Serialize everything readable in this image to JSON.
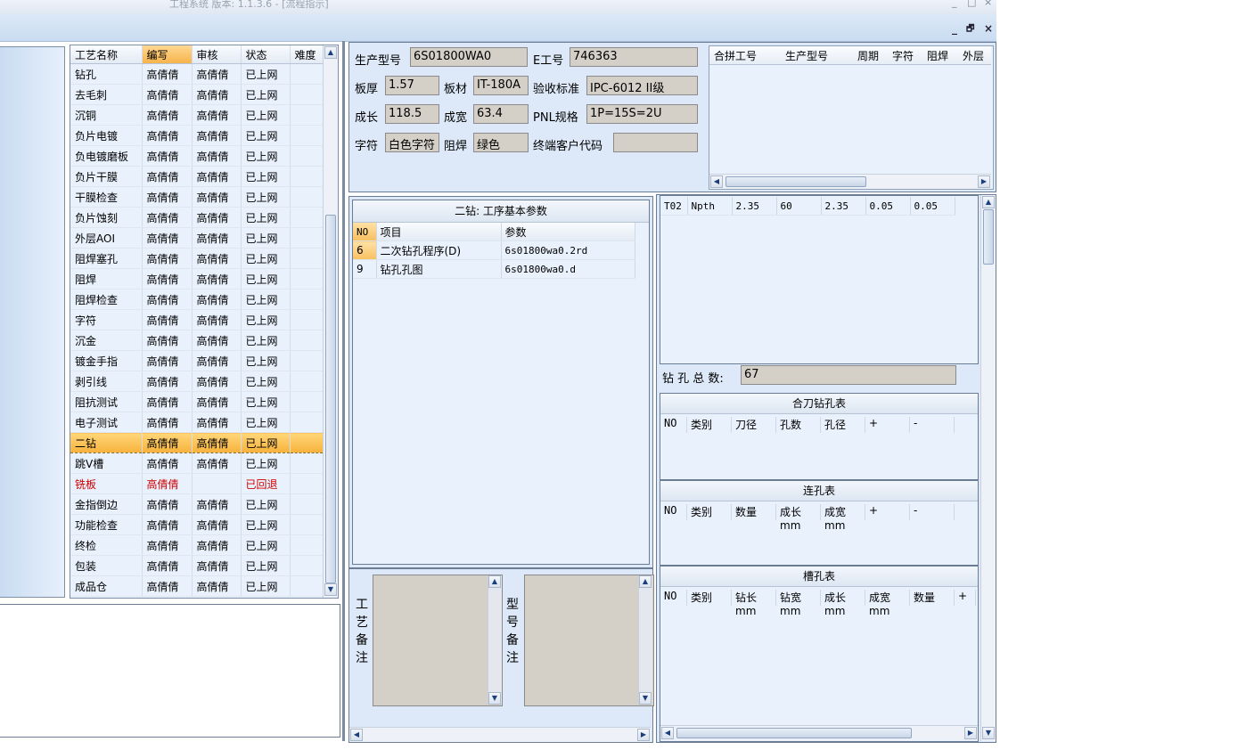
{
  "window": {
    "title": "工程系统 版本: 1.1.3.6 - [流程指示]",
    "controls": [
      "_",
      "□",
      "×"
    ],
    "mdi_controls": [
      "_",
      "🗗",
      "×"
    ]
  },
  "process_list": {
    "columns": [
      "工艺名称",
      "编写",
      "审核",
      "状态",
      "难度"
    ],
    "rows": [
      {
        "name": "钻孔",
        "writer": "高倩倩",
        "reviewer": "高倩倩",
        "status": "已上网",
        "difficulty": ""
      },
      {
        "name": "去毛刺",
        "writer": "高倩倩",
        "reviewer": "高倩倩",
        "status": "已上网",
        "difficulty": ""
      },
      {
        "name": "沉铜",
        "writer": "高倩倩",
        "reviewer": "高倩倩",
        "status": "已上网",
        "difficulty": ""
      },
      {
        "name": "负片电镀",
        "writer": "高倩倩",
        "reviewer": "高倩倩",
        "status": "已上网",
        "difficulty": ""
      },
      {
        "name": "负电镀磨板",
        "writer": "高倩倩",
        "reviewer": "高倩倩",
        "status": "已上网",
        "difficulty": ""
      },
      {
        "name": "负片干膜",
        "writer": "高倩倩",
        "reviewer": "高倩倩",
        "status": "已上网",
        "difficulty": ""
      },
      {
        "name": "干膜检查",
        "writer": "高倩倩",
        "reviewer": "高倩倩",
        "status": "已上网",
        "difficulty": ""
      },
      {
        "name": "负片蚀刻",
        "writer": "高倩倩",
        "reviewer": "高倩倩",
        "status": "已上网",
        "difficulty": ""
      },
      {
        "name": "外层AOI",
        "writer": "高倩倩",
        "reviewer": "高倩倩",
        "status": "已上网",
        "difficulty": ""
      },
      {
        "name": "阻焊塞孔",
        "writer": "高倩倩",
        "reviewer": "高倩倩",
        "status": "已上网",
        "difficulty": ""
      },
      {
        "name": "阻焊",
        "writer": "高倩倩",
        "reviewer": "高倩倩",
        "status": "已上网",
        "difficulty": ""
      },
      {
        "name": "阻焊检查",
        "writer": "高倩倩",
        "reviewer": "高倩倩",
        "status": "已上网",
        "difficulty": ""
      },
      {
        "name": "字符",
        "writer": "高倩倩",
        "reviewer": "高倩倩",
        "status": "已上网",
        "difficulty": ""
      },
      {
        "name": "沉金",
        "writer": "高倩倩",
        "reviewer": "高倩倩",
        "status": "已上网",
        "difficulty": ""
      },
      {
        "name": "镀金手指",
        "writer": "高倩倩",
        "reviewer": "高倩倩",
        "status": "已上网",
        "difficulty": ""
      },
      {
        "name": "剥引线",
        "writer": "高倩倩",
        "reviewer": "高倩倩",
        "status": "已上网",
        "difficulty": ""
      },
      {
        "name": "阻抗测试",
        "writer": "高倩倩",
        "reviewer": "高倩倩",
        "status": "已上网",
        "difficulty": ""
      },
      {
        "name": "电子测试",
        "writer": "高倩倩",
        "reviewer": "高倩倩",
        "status": "已上网",
        "difficulty": ""
      },
      {
        "name": "二钻",
        "writer": "高倩倩",
        "reviewer": "高倩倩",
        "status": "已上网",
        "difficulty": "",
        "selected": true
      },
      {
        "name": "跳V槽",
        "writer": "高倩倩",
        "reviewer": "高倩倩",
        "status": "已上网",
        "difficulty": ""
      },
      {
        "name": "铣板",
        "writer": "高倩倩",
        "reviewer": "",
        "status": "已回退",
        "difficulty": "",
        "returned": true
      },
      {
        "name": "金指倒边",
        "writer": "高倩倩",
        "reviewer": "高倩倩",
        "status": "已上网",
        "difficulty": ""
      },
      {
        "name": "功能检查",
        "writer": "高倩倩",
        "reviewer": "高倩倩",
        "status": "已上网",
        "difficulty": ""
      },
      {
        "name": "终检",
        "writer": "高倩倩",
        "reviewer": "高倩倩",
        "status": "已上网",
        "difficulty": ""
      },
      {
        "name": "包装",
        "writer": "高倩倩",
        "reviewer": "高倩倩",
        "status": "已上网",
        "difficulty": ""
      },
      {
        "name": "成品仓",
        "writer": "高倩倩",
        "reviewer": "高倩倩",
        "status": "已上网",
        "difficulty": ""
      }
    ]
  },
  "info": {
    "model_label": "生产型号",
    "model_value": "6S01800WA0",
    "eno_label": "E工号",
    "eno_value": "746363",
    "thickness_label": "板厚",
    "thickness_value": "1.57",
    "material_label": "板材",
    "material_value": "IT-180A",
    "standard_label": "验收标准",
    "standard_value": "IPC-6012 II级",
    "length_label": "成长",
    "length_value": "118.5",
    "width_label": "成宽",
    "width_value": "63.4",
    "pnl_label": "PNL规格",
    "pnl_value": "1P=15S=2U",
    "char_label": "字符",
    "char_value": "白色字符",
    "mask_label": "阻焊",
    "mask_value": "绿色",
    "customer_label": "终端客户代码",
    "customer_value": ""
  },
  "merge_table": {
    "columns": [
      "合拼工号",
      "生产型号",
      "周期",
      "字符",
      "阻焊",
      "外层"
    ]
  },
  "params": {
    "title": "二钻: 工序基本参数",
    "columns": [
      "NO",
      "项目",
      "参数"
    ],
    "rows": [
      {
        "no": "6",
        "item": "二次钻孔程序(D)",
        "value": "6s01800wa0.2rd"
      },
      {
        "no": "9",
        "item": "钻孔孔图",
        "value": "6s01800wa0.d"
      }
    ]
  },
  "remarks": {
    "process_label": "工艺备注",
    "model_label": "型号备注",
    "process_value": "",
    "model_value": ""
  },
  "tools": {
    "rows": [
      [
        "T02",
        "Npth",
        "2.35",
        "60",
        "2.35",
        "0.05",
        "0.05"
      ]
    ],
    "total_label": "钻 孔 总 数:",
    "total_value": "67"
  },
  "combined_table": {
    "title": "合刀钻孔表",
    "columns": [
      "NO",
      "类别",
      "刀径",
      "孔数",
      "孔径",
      "+",
      "-"
    ]
  },
  "linked_table": {
    "title": "连孔表",
    "columns": [
      "NO",
      "类别",
      "数量",
      "成长mm",
      "成宽mm",
      "+",
      "-"
    ]
  },
  "slot_table": {
    "title": "槽孔表",
    "columns": [
      "NO",
      "类别",
      "钻长mm",
      "钻宽mm",
      "成长mm",
      "成宽mm",
      "数量",
      "+"
    ]
  }
}
